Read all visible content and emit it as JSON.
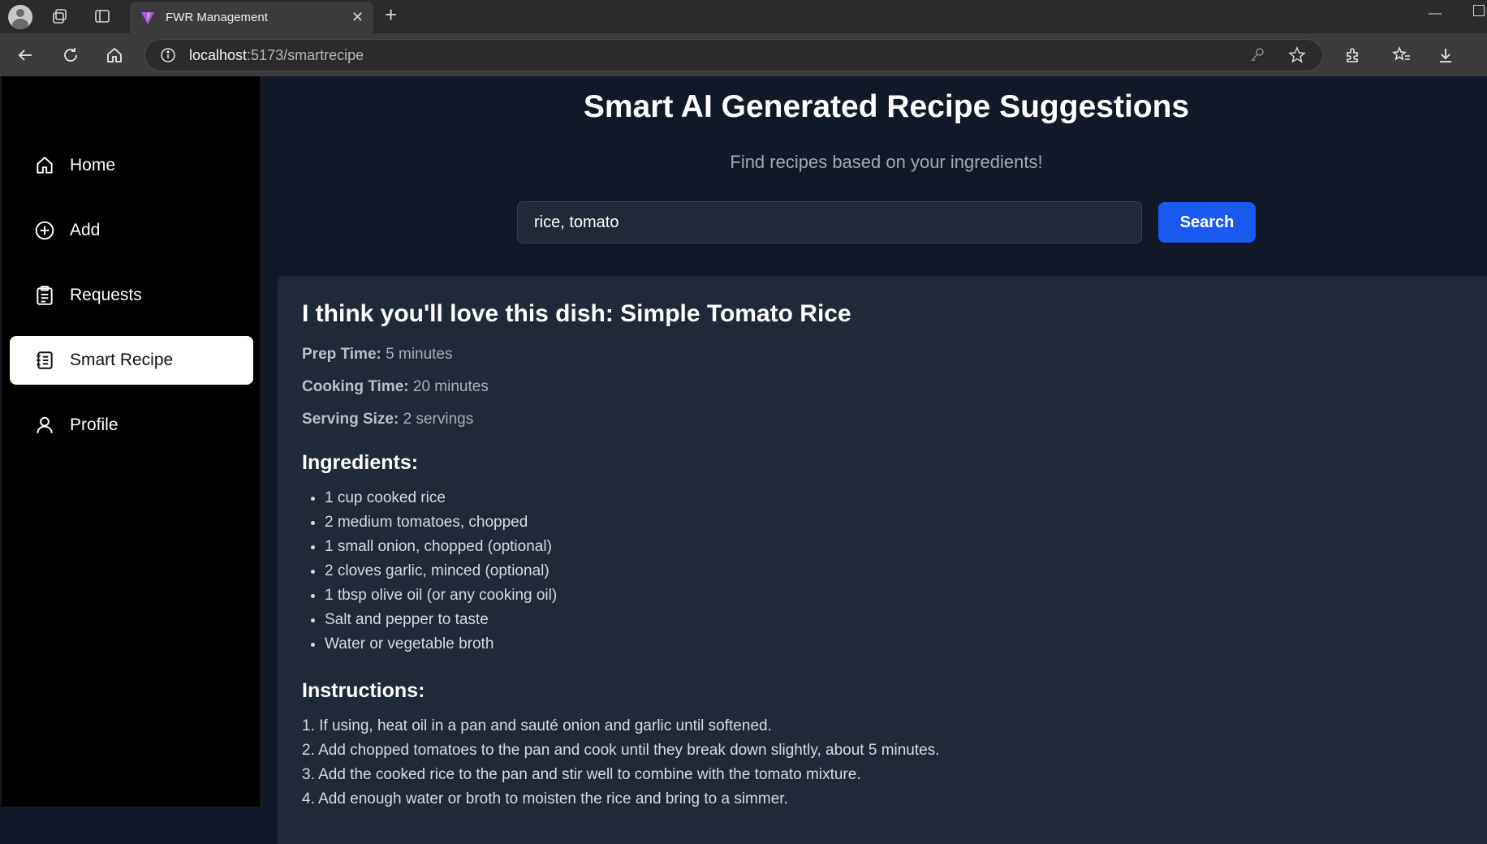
{
  "browser": {
    "tab_title": "FWR Management",
    "url_host": "localhost",
    "url_path": ":5173/smartrecipe"
  },
  "sidebar": {
    "items": [
      {
        "label": "Home",
        "icon": "home-icon"
      },
      {
        "label": "Add",
        "icon": "plus-circle-icon"
      },
      {
        "label": "Requests",
        "icon": "clipboard-icon"
      },
      {
        "label": "Smart Recipe",
        "icon": "recipe-book-icon",
        "active": true
      },
      {
        "label": "Profile",
        "icon": "user-icon"
      }
    ]
  },
  "header": {
    "title": "Smart AI Generated Recipe Suggestions",
    "subtitle": "Find recipes based on your ingredients!"
  },
  "search": {
    "value": "rice, tomato",
    "button_label": "Search"
  },
  "recipe": {
    "heading": "I think you'll love this dish: Simple Tomato Rice",
    "prep_label": "Prep Time:",
    "prep_value": "5 minutes",
    "cook_label": "Cooking Time:",
    "cook_value": "20 minutes",
    "serving_label": "Serving Size:",
    "serving_value": "2 servings",
    "ingredients_heading": "Ingredients:",
    "ingredients": [
      "1 cup cooked rice",
      "2 medium tomatoes, chopped",
      "1 small onion, chopped (optional)",
      "2 cloves garlic, minced (optional)",
      "1 tbsp olive oil (or any cooking oil)",
      "Salt and pepper to taste",
      "Water or vegetable broth"
    ],
    "instructions_heading": "Instructions:",
    "instructions": [
      "1. If using, heat oil in a pan and sauté onion and garlic until softened.",
      "2. Add chopped tomatoes to the pan and cook until they break down slightly, about 5 minutes.",
      "3. Add the cooked rice to the pan and stir well to combine with the tomato mixture.",
      "4. Add enough water or broth to moisten the rice and bring to a simmer."
    ]
  }
}
